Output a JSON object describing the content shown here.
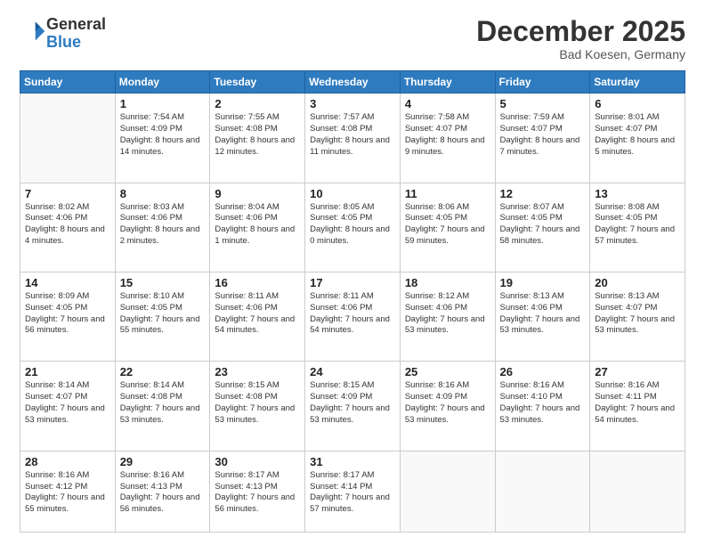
{
  "logo": {
    "general": "General",
    "blue": "Blue"
  },
  "header": {
    "month": "December 2025",
    "location": "Bad Koesen, Germany"
  },
  "weekdays": [
    "Sunday",
    "Monday",
    "Tuesday",
    "Wednesday",
    "Thursday",
    "Friday",
    "Saturday"
  ],
  "weeks": [
    [
      {
        "day": "",
        "info": ""
      },
      {
        "day": "1",
        "info": "Sunrise: 7:54 AM\nSunset: 4:09 PM\nDaylight: 8 hours\nand 14 minutes."
      },
      {
        "day": "2",
        "info": "Sunrise: 7:55 AM\nSunset: 4:08 PM\nDaylight: 8 hours\nand 12 minutes."
      },
      {
        "day": "3",
        "info": "Sunrise: 7:57 AM\nSunset: 4:08 PM\nDaylight: 8 hours\nand 11 minutes."
      },
      {
        "day": "4",
        "info": "Sunrise: 7:58 AM\nSunset: 4:07 PM\nDaylight: 8 hours\nand 9 minutes."
      },
      {
        "day": "5",
        "info": "Sunrise: 7:59 AM\nSunset: 4:07 PM\nDaylight: 8 hours\nand 7 minutes."
      },
      {
        "day": "6",
        "info": "Sunrise: 8:01 AM\nSunset: 4:07 PM\nDaylight: 8 hours\nand 5 minutes."
      }
    ],
    [
      {
        "day": "7",
        "info": "Sunrise: 8:02 AM\nSunset: 4:06 PM\nDaylight: 8 hours\nand 4 minutes."
      },
      {
        "day": "8",
        "info": "Sunrise: 8:03 AM\nSunset: 4:06 PM\nDaylight: 8 hours\nand 2 minutes."
      },
      {
        "day": "9",
        "info": "Sunrise: 8:04 AM\nSunset: 4:06 PM\nDaylight: 8 hours\nand 1 minute."
      },
      {
        "day": "10",
        "info": "Sunrise: 8:05 AM\nSunset: 4:05 PM\nDaylight: 8 hours\nand 0 minutes."
      },
      {
        "day": "11",
        "info": "Sunrise: 8:06 AM\nSunset: 4:05 PM\nDaylight: 7 hours\nand 59 minutes."
      },
      {
        "day": "12",
        "info": "Sunrise: 8:07 AM\nSunset: 4:05 PM\nDaylight: 7 hours\nand 58 minutes."
      },
      {
        "day": "13",
        "info": "Sunrise: 8:08 AM\nSunset: 4:05 PM\nDaylight: 7 hours\nand 57 minutes."
      }
    ],
    [
      {
        "day": "14",
        "info": "Sunrise: 8:09 AM\nSunset: 4:05 PM\nDaylight: 7 hours\nand 56 minutes."
      },
      {
        "day": "15",
        "info": "Sunrise: 8:10 AM\nSunset: 4:05 PM\nDaylight: 7 hours\nand 55 minutes."
      },
      {
        "day": "16",
        "info": "Sunrise: 8:11 AM\nSunset: 4:06 PM\nDaylight: 7 hours\nand 54 minutes."
      },
      {
        "day": "17",
        "info": "Sunrise: 8:11 AM\nSunset: 4:06 PM\nDaylight: 7 hours\nand 54 minutes."
      },
      {
        "day": "18",
        "info": "Sunrise: 8:12 AM\nSunset: 4:06 PM\nDaylight: 7 hours\nand 53 minutes."
      },
      {
        "day": "19",
        "info": "Sunrise: 8:13 AM\nSunset: 4:06 PM\nDaylight: 7 hours\nand 53 minutes."
      },
      {
        "day": "20",
        "info": "Sunrise: 8:13 AM\nSunset: 4:07 PM\nDaylight: 7 hours\nand 53 minutes."
      }
    ],
    [
      {
        "day": "21",
        "info": "Sunrise: 8:14 AM\nSunset: 4:07 PM\nDaylight: 7 hours\nand 53 minutes."
      },
      {
        "day": "22",
        "info": "Sunrise: 8:14 AM\nSunset: 4:08 PM\nDaylight: 7 hours\nand 53 minutes."
      },
      {
        "day": "23",
        "info": "Sunrise: 8:15 AM\nSunset: 4:08 PM\nDaylight: 7 hours\nand 53 minutes."
      },
      {
        "day": "24",
        "info": "Sunrise: 8:15 AM\nSunset: 4:09 PM\nDaylight: 7 hours\nand 53 minutes."
      },
      {
        "day": "25",
        "info": "Sunrise: 8:16 AM\nSunset: 4:09 PM\nDaylight: 7 hours\nand 53 minutes."
      },
      {
        "day": "26",
        "info": "Sunrise: 8:16 AM\nSunset: 4:10 PM\nDaylight: 7 hours\nand 53 minutes."
      },
      {
        "day": "27",
        "info": "Sunrise: 8:16 AM\nSunset: 4:11 PM\nDaylight: 7 hours\nand 54 minutes."
      }
    ],
    [
      {
        "day": "28",
        "info": "Sunrise: 8:16 AM\nSunset: 4:12 PM\nDaylight: 7 hours\nand 55 minutes."
      },
      {
        "day": "29",
        "info": "Sunrise: 8:16 AM\nSunset: 4:13 PM\nDaylight: 7 hours\nand 56 minutes."
      },
      {
        "day": "30",
        "info": "Sunrise: 8:17 AM\nSunset: 4:13 PM\nDaylight: 7 hours\nand 56 minutes."
      },
      {
        "day": "31",
        "info": "Sunrise: 8:17 AM\nSunset: 4:14 PM\nDaylight: 7 hours\nand 57 minutes."
      },
      {
        "day": "",
        "info": ""
      },
      {
        "day": "",
        "info": ""
      },
      {
        "day": "",
        "info": ""
      }
    ]
  ]
}
